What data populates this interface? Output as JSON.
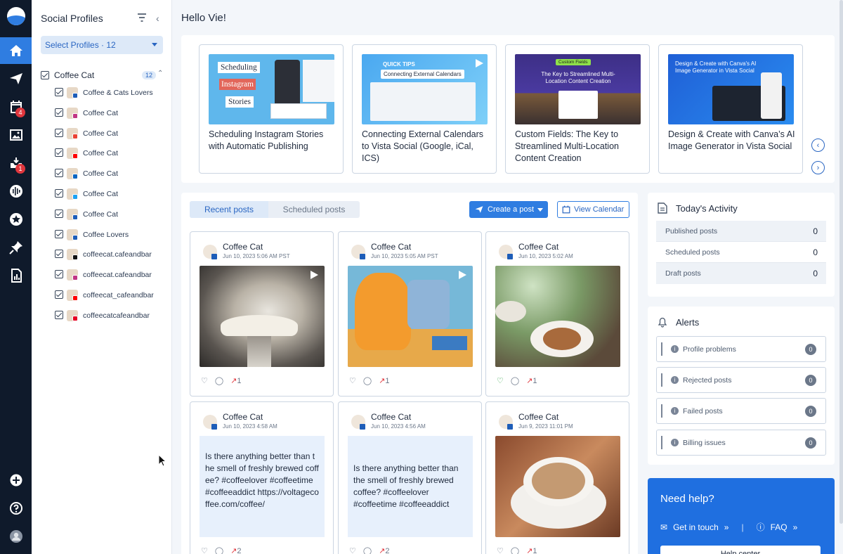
{
  "sidebar_rail": {
    "items": [
      {
        "name": "home",
        "active": true
      },
      {
        "name": "publish"
      },
      {
        "name": "calendar",
        "badge": "4"
      },
      {
        "name": "media"
      },
      {
        "name": "inbox",
        "badge": "1"
      },
      {
        "name": "listening"
      },
      {
        "name": "reviews"
      },
      {
        "name": "pins"
      },
      {
        "name": "reports"
      }
    ]
  },
  "profiles_panel": {
    "title": "Social Profiles",
    "select_label": "Select Profiles · 12",
    "group": {
      "label": "Coffee Cat",
      "count": "12"
    },
    "profiles": [
      {
        "label": "Coffee & Cats Lovers",
        "network_color": "#1e5db8"
      },
      {
        "label": "Coffee Cat",
        "network_color": "#c13584"
      },
      {
        "label": "Coffee Cat",
        "network_color": "#ea4335"
      },
      {
        "label": "Coffee Cat",
        "network_color": "#ff0000"
      },
      {
        "label": "Coffee Cat",
        "network_color": "#0a66c2"
      },
      {
        "label": "Coffee Cat",
        "network_color": "#1da1f2"
      },
      {
        "label": "Coffee Cat",
        "network_color": "#1e5db8"
      },
      {
        "label": "Coffee Lovers",
        "network_color": "#1e5db8"
      },
      {
        "label": "coffeecat.cafeandbar",
        "network_color": "#111111"
      },
      {
        "label": "coffeecat.cafeandbar",
        "network_color": "#c13584"
      },
      {
        "label": "coffeecat_cafeandbar",
        "network_color": "#ff0000"
      },
      {
        "label": "coffeecatcafeandbar",
        "network_color": "#e60023"
      }
    ]
  },
  "greeting": "Hello Vie!",
  "tips": [
    {
      "title": "Scheduling Instagram Stories with Automatic Publishing",
      "thumb_lines": [
        "Scheduling",
        "Instagram",
        "Stories"
      ]
    },
    {
      "title": "Connecting External Calendars to Vista Social (Google, iCal, ICS)",
      "thumb_lines": [
        "QUICK TIPS",
        "Connecting External Calendars"
      ]
    },
    {
      "title": "Custom Fields: The Key to Streamlined Multi-Location Content Creation",
      "thumb_lines": [
        "Custom Fields",
        "The Key to Streamlined Multi-",
        "Location Content Creation"
      ]
    },
    {
      "title": "Design & Create with Canva’s AI Image Generator in Vista Social",
      "thumb_lines": [
        "Design & Create with Canva's AI",
        "Image Generator in Vista Social"
      ]
    }
  ],
  "posts_panel": {
    "tabs": [
      "Recent posts",
      "Scheduled posts"
    ],
    "create_label": "Create a post",
    "calendar_label": "View Calendar",
    "posts": [
      {
        "name": "Coffee Cat",
        "date": "Jun 10, 2023 5:06 AM PST",
        "media": "coffee-pour",
        "video": true,
        "stat": "1"
      },
      {
        "name": "Coffee Cat",
        "date": "Jun 10, 2023 5:05 AM PST",
        "media": "cartoon-cat",
        "video": true,
        "stat": "1"
      },
      {
        "name": "Coffee Cat",
        "date": "Jun 10, 2023 5:02 AM",
        "media": "latte-art",
        "video": false,
        "stat": "1"
      },
      {
        "name": "Coffee Cat",
        "date": "Jun 10, 2023 4:58 AM",
        "text": "Is there anything better than the smell of freshly brewed coffee? #coffeelover #coffeetime #coffeeaddict https://voltagecoffee.com/coffee/",
        "stat": "2"
      },
      {
        "name": "Coffee Cat",
        "date": "Jun 10, 2023 4:56 AM",
        "text": "Is there anything better than the smell of freshly brewed coffee? #coffeelover #coffeetime #coffeeaddict",
        "stat": "2"
      },
      {
        "name": "Coffee Cat",
        "date": "Jun 9, 2023 11:01 PM",
        "media": "cappuccino",
        "video": false,
        "stat": "1"
      }
    ]
  },
  "activity": {
    "title": "Today's Activity",
    "rows": [
      {
        "label": "Published posts",
        "value": "0"
      },
      {
        "label": "Scheduled posts",
        "value": "0"
      },
      {
        "label": "Draft posts",
        "value": "0"
      }
    ]
  },
  "alerts": {
    "title": "Alerts",
    "rows": [
      {
        "label": "Profile problems",
        "value": "0"
      },
      {
        "label": "Rejected posts",
        "value": "0"
      },
      {
        "label": "Failed posts",
        "value": "0"
      },
      {
        "label": "Billing issues",
        "value": "0"
      }
    ]
  },
  "help": {
    "title": "Need help?",
    "get_in_touch": "Get in touch",
    "faq": "FAQ",
    "button": "Help center"
  },
  "colors": {
    "accent": "#2f7de1",
    "rail": "#0f1a2b",
    "alert_badge": "#e0363d"
  }
}
